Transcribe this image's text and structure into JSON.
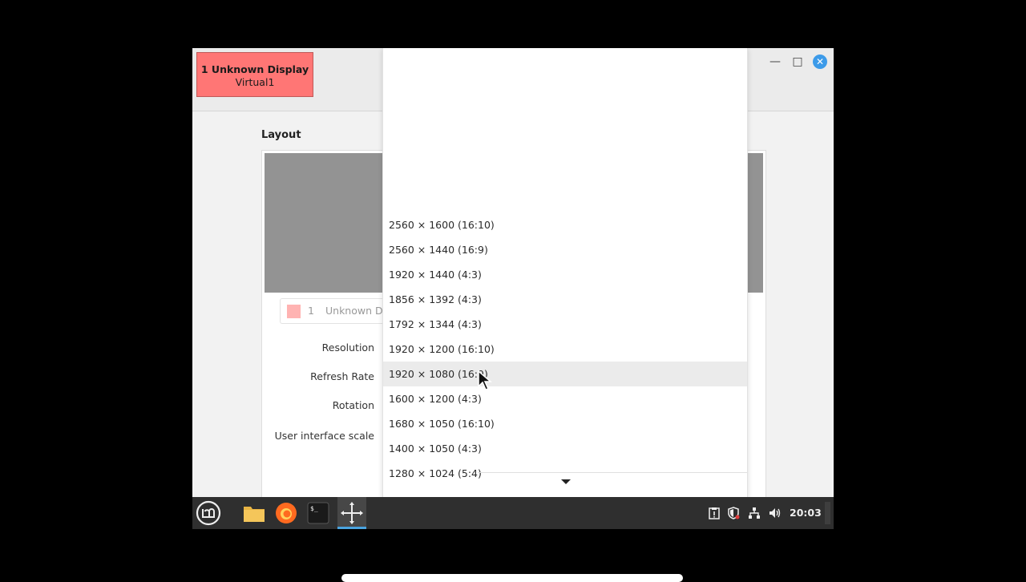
{
  "window": {
    "display_badge": {
      "line1": "1  Unknown Display",
      "line2": "Virtual1"
    },
    "controls": {
      "minimize_icon": "minimize-icon",
      "maximize_icon": "maximize-icon",
      "close_icon": "close-icon"
    }
  },
  "layout": {
    "title": "Layout"
  },
  "monitor_selector": {
    "swatch_color": "#ffb3b2",
    "number": "1",
    "label": "Unknown D"
  },
  "settings": {
    "resolution_label": "Resolution",
    "refresh_rate_label": "Refresh Rate",
    "rotation_label": "Rotation",
    "ui_scale_label": "User interface scale"
  },
  "resolution_menu": {
    "items": [
      "2560 × 1600 (16:10)",
      "2560 × 1440 (16:9)",
      "1920 × 1440 (4:3)",
      "1856 × 1392 (4:3)",
      "1792 × 1344 (4:3)",
      "1920 × 1200 (16:10)",
      "1920 × 1080 (16:9)",
      "1600 × 1200 (4:3)",
      "1680 × 1050 (16:10)",
      "1400 × 1050 (4:3)",
      "1280 × 1024 (5:4)"
    ],
    "hovered_item": "1920 × 1080 (16:9)",
    "scroll_icon": "scroll-down-arrow-icon"
  },
  "taskbar": {
    "apps": [
      "menu-icon",
      "files-icon",
      "firefox-icon",
      "terminal-icon",
      "display-settings-icon"
    ],
    "tray": [
      "clipboard-icon",
      "shield-icon",
      "network-icon",
      "volume-icon"
    ],
    "clock": "20:03"
  },
  "colors": {
    "accent": "#3d9be9",
    "display_badge": "#ff7675",
    "taskbar": "#2f2f2f"
  }
}
